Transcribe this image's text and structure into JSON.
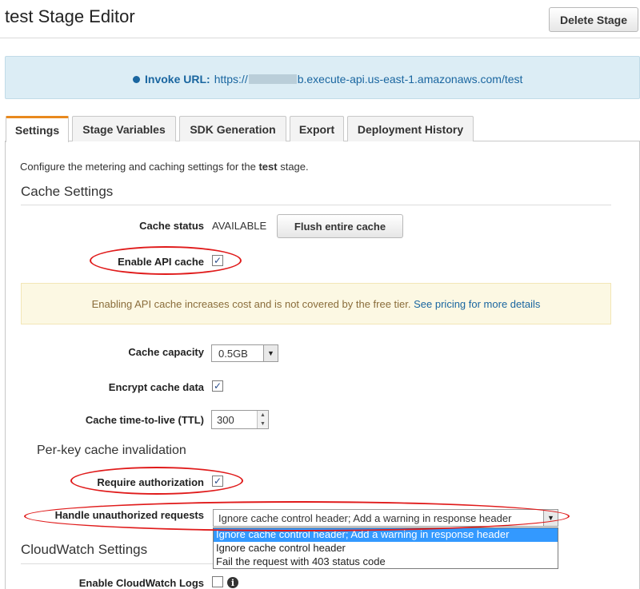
{
  "header": {
    "title": "test Stage Editor",
    "delete_button": "Delete Stage"
  },
  "invoke": {
    "label": "Invoke URL:",
    "url_prefix": "https://",
    "url_suffix": "b.execute-api.us-east-1.amazonaws.com/test"
  },
  "tabs": [
    {
      "label": "Settings",
      "active": true
    },
    {
      "label": "Stage Variables",
      "active": false
    },
    {
      "label": "SDK Generation",
      "active": false
    },
    {
      "label": "Export",
      "active": false
    },
    {
      "label": "Deployment History",
      "active": false
    }
  ],
  "settings": {
    "description_before": "Configure the metering and caching settings for the ",
    "description_stage": "test",
    "description_after": " stage.",
    "cache_section_title": "Cache Settings",
    "cache_status_label": "Cache status",
    "cache_status_value": "AVAILABLE",
    "flush_button": "Flush entire cache",
    "enable_cache_label": "Enable API cache",
    "enable_cache_checked": true,
    "warning_text": "Enabling API cache increases cost and is not covered by the free tier. ",
    "warning_link": "See pricing for more details",
    "capacity_label": "Cache capacity",
    "capacity_value": "0.5GB",
    "encrypt_label": "Encrypt cache data",
    "encrypt_checked": true,
    "ttl_label": "Cache time-to-live (TTL)",
    "ttl_value": "300",
    "per_key_title": "Per-key cache invalidation",
    "require_auth_label": "Require authorization",
    "require_auth_checked": true,
    "unauth_label": "Handle unauthorized requests",
    "unauth_value": "Ignore cache control header; Add a warning in response header",
    "unauth_options": [
      "Ignore cache control header; Add a warning in response header",
      "Ignore cache control header",
      "Fail the request with 403 status code"
    ],
    "cloudwatch_title": "CloudWatch Settings",
    "cloudwatch_logs_label": "Enable CloudWatch Logs",
    "cloudwatch_logs_checked": false
  },
  "colors": {
    "accent_tab": "#e8891e",
    "link": "#1a66a0",
    "annotation": "#e01b1b",
    "selected_option": "#3399ff"
  },
  "icons": {
    "check": "✓",
    "down": "▼",
    "up": "▲",
    "info": "i"
  }
}
